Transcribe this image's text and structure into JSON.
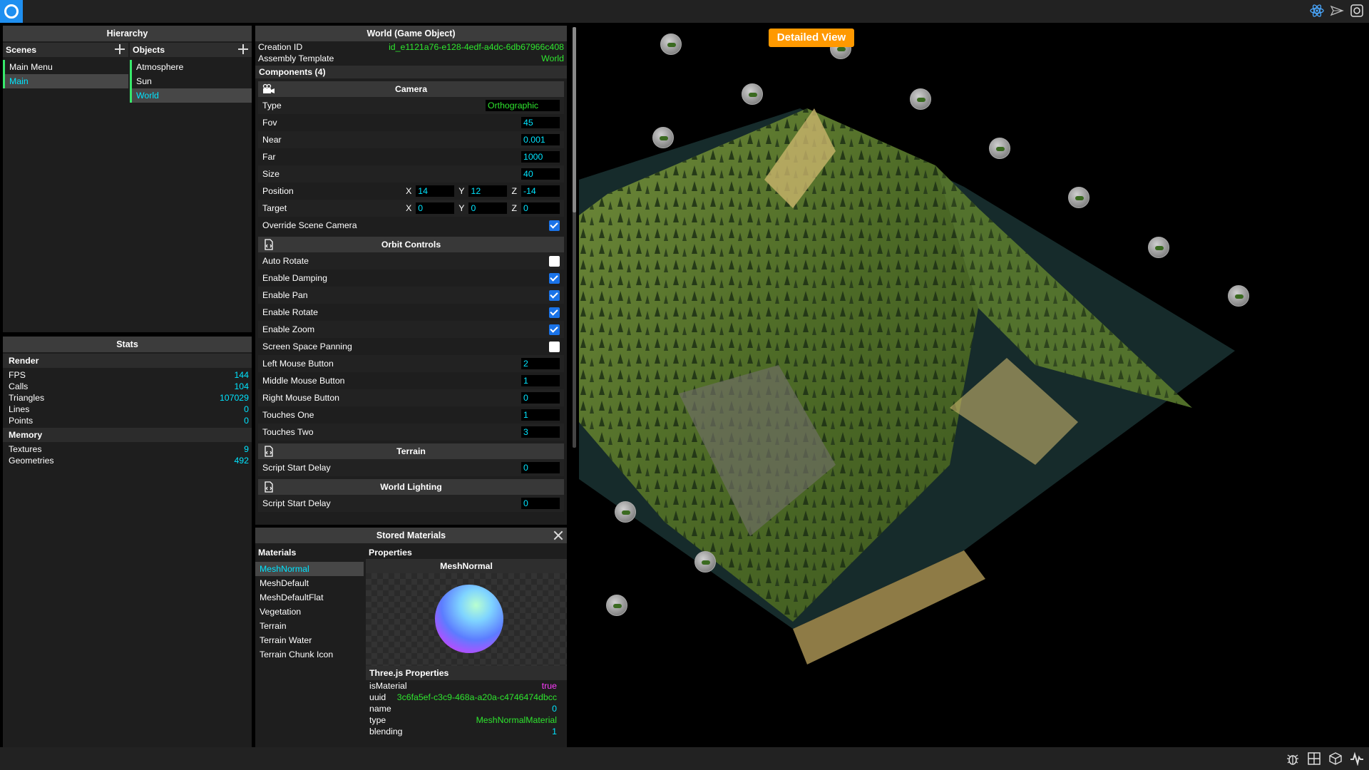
{
  "hierarchy": {
    "title": "Hierarchy",
    "scenes_header": "Scenes",
    "objects_header": "Objects",
    "scenes": [
      "Main Menu",
      "Main"
    ],
    "selected_scene": 1,
    "objects": [
      "Atmosphere",
      "Sun",
      "World"
    ],
    "selected_object": 2
  },
  "stats": {
    "title": "Stats",
    "render_header": "Render",
    "render": [
      {
        "label": "FPS",
        "value": "144"
      },
      {
        "label": "Calls",
        "value": "104"
      },
      {
        "label": "Triangles",
        "value": "107029"
      },
      {
        "label": "Lines",
        "value": "0"
      },
      {
        "label": "Points",
        "value": "0"
      }
    ],
    "memory_header": "Memory",
    "memory": [
      {
        "label": "Textures",
        "value": "9"
      },
      {
        "label": "Geometries",
        "value": "492"
      }
    ]
  },
  "inspector": {
    "title": "World (Game Object)",
    "creation_id_label": "Creation ID",
    "creation_id": "id_e1121a76-e128-4edf-a4dc-6db67966c408",
    "assembly_label": "Assembly Template",
    "assembly": "World",
    "components_header": "Components (4)",
    "camera": {
      "title": "Camera",
      "type_label": "Type",
      "type": "Orthographic",
      "fov_label": "Fov",
      "fov": "45",
      "near_label": "Near",
      "near": "0.001",
      "far_label": "Far",
      "far": "1000",
      "size_label": "Size",
      "size": "40",
      "position_label": "Position",
      "pos_x": "14",
      "pos_y": "12",
      "pos_z": "-14",
      "target_label": "Target",
      "tgt_x": "0",
      "tgt_y": "0",
      "tgt_z": "0",
      "x": "X",
      "y": "Y",
      "z": "Z",
      "override_label": "Override Scene Camera",
      "override": true
    },
    "orbit": {
      "title": "Orbit Controls",
      "auto_rotate": "Auto Rotate",
      "enable_damping": "Enable Damping",
      "enable_pan": "Enable Pan",
      "enable_rotate": "Enable Rotate",
      "enable_zoom": "Enable Zoom",
      "screen_space_panning": "Screen Space Panning",
      "left_mouse_label": "Left Mouse Button",
      "left_mouse": "2",
      "middle_mouse_label": "Middle Mouse Button",
      "middle_mouse": "1",
      "right_mouse_label": "Right Mouse Button",
      "right_mouse": "0",
      "touches_one_label": "Touches One",
      "touches_one": "1",
      "touches_two_label": "Touches Two",
      "touches_two": "3"
    },
    "terrain": {
      "title": "Terrain",
      "delay_label": "Script Start Delay",
      "delay": "0"
    },
    "lighting": {
      "title": "World Lighting",
      "delay_label": "Script Start Delay",
      "delay": "0"
    }
  },
  "materials": {
    "title": "Stored Materials",
    "list_header": "Materials",
    "props_header": "Properties",
    "items": [
      "MeshNormal",
      "MeshDefault",
      "MeshDefaultFlat",
      "Vegetation",
      "Terrain",
      "Terrain Water",
      "Terrain Chunk Icon"
    ],
    "selected_item": 0,
    "selected_name": "MeshNormal",
    "threejs_header": "Three.js Properties",
    "threejs": [
      {
        "label": "isMaterial",
        "value": "true"
      },
      {
        "label": "uuid",
        "value": "3c6fa5ef-c3c9-468a-a20a-c4746474dbcc"
      },
      {
        "label": "name",
        "value": "0"
      },
      {
        "label": "type",
        "value": "MeshNormalMaterial"
      },
      {
        "label": "blending",
        "value": "1"
      }
    ]
  },
  "viewport": {
    "badge": "Detailed View"
  },
  "colors": {
    "accent_cyan": "#00e5ff",
    "accent_green": "#2ee62e",
    "badge_orange": "#ff9900",
    "checkbox_blue": "#1a73e8"
  }
}
